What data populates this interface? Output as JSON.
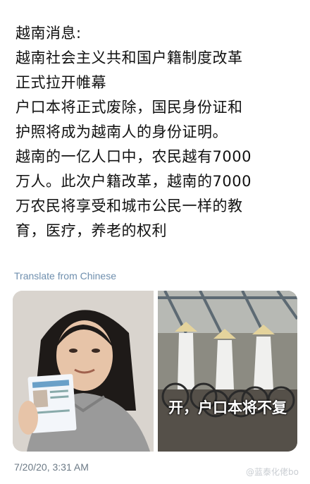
{
  "tweet": {
    "lines": [
      "越南消息:",
      "越南社会主义共和国户籍制度改革",
      "正式拉开帷幕",
      "户口本将正式废除，国民身份证和",
      "护照将成为越南人的身份证明。",
      "越南的一亿人口中，农民越有7000",
      "万人。此次户籍改革，越南的7000",
      "万农民将享受和城市公民一样的教",
      "育，医疗，养老的权利"
    ],
    "translate_label": "Translate from Chinese",
    "timestamp": "7/20/20, 3:31 AM"
  },
  "media": {
    "right_caption": "开，户口本将不复"
  },
  "watermark": "@蓝泰化佬bo"
}
